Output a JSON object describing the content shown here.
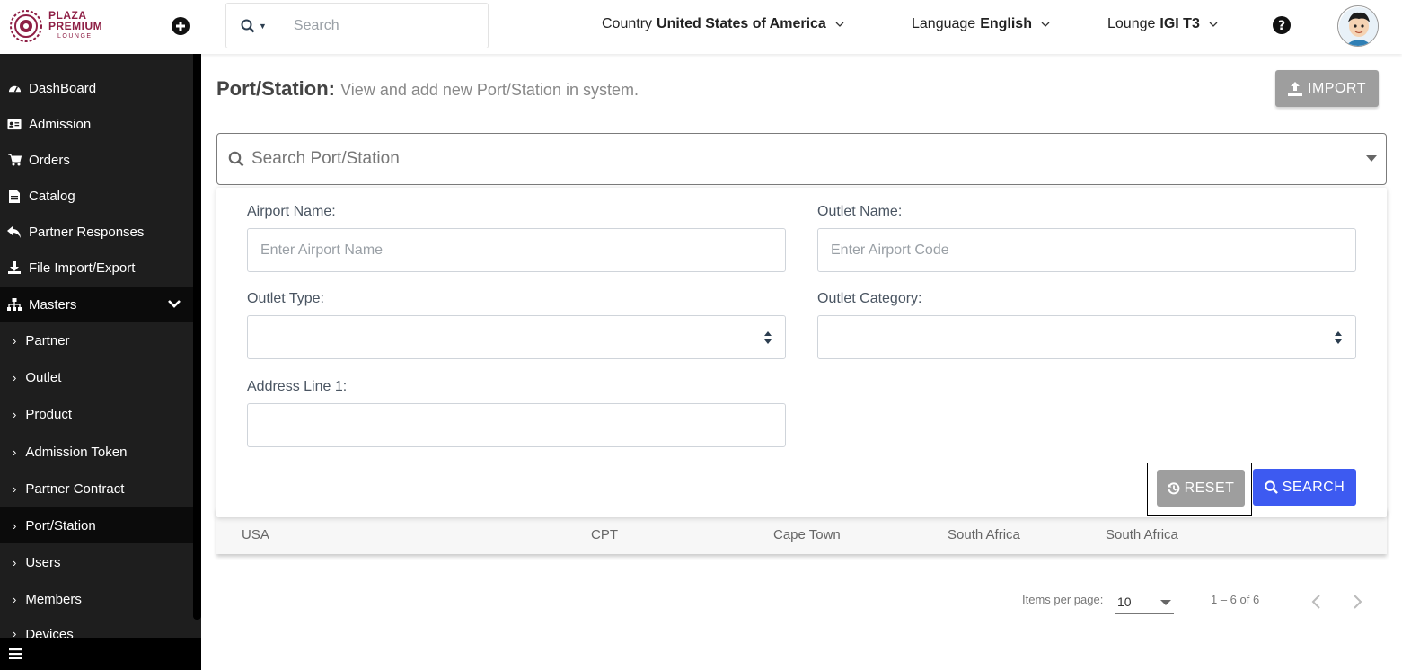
{
  "brand": {
    "line1": "PLAZA",
    "line2": "PREMIUM",
    "line3": "LOUNGE",
    "color": "#8e1f45"
  },
  "topbar": {
    "search_placeholder": "Search",
    "country": {
      "label": "Country",
      "value": "United States of America"
    },
    "language": {
      "label": "Language",
      "value": "English"
    },
    "lounge": {
      "label": "Lounge",
      "value": "IGI T3"
    }
  },
  "sidebar": {
    "items": [
      {
        "label": "DashBoard",
        "icon": "dashboard-icon"
      },
      {
        "label": "Admission",
        "icon": "id-card-icon"
      },
      {
        "label": "Orders",
        "icon": "cart-icon"
      },
      {
        "label": "Catalog",
        "icon": "file-icon"
      },
      {
        "label": "Partner Responses",
        "icon": "reply-icon"
      },
      {
        "label": "File Import/Export",
        "icon": "download-icon"
      },
      {
        "label": "Masters",
        "icon": "sitemap-icon"
      }
    ],
    "sub_items": [
      {
        "label": "Partner"
      },
      {
        "label": "Outlet"
      },
      {
        "label": "Product"
      },
      {
        "label": "Admission Token"
      },
      {
        "label": "Partner Contract"
      },
      {
        "label": "Port/Station",
        "active": true
      },
      {
        "label": "Users"
      },
      {
        "label": "Members"
      },
      {
        "label": "Devices"
      }
    ]
  },
  "page": {
    "title": "Port/Station:",
    "description": "View and add new Port/Station in system.",
    "import_label": "IMPORT",
    "search_placeholder": "Search Port/Station"
  },
  "filters": {
    "airport_name": {
      "label": "Airport Name:",
      "placeholder": "Enter Airport Name"
    },
    "outlet_name": {
      "label": "Outlet Name:",
      "placeholder": "Enter Airport Code"
    },
    "outlet_type": {
      "label": "Outlet Type:",
      "value": ""
    },
    "outlet_category": {
      "label": "Outlet Category:",
      "value": ""
    },
    "address_line_1": {
      "label": "Address Line 1:",
      "value": ""
    },
    "reset_label": "RESET",
    "search_label": "SEARCH"
  },
  "table": {
    "rows": [
      [
        "USA",
        "CPT",
        "Cape Town",
        "South Africa",
        "South Africa"
      ]
    ]
  },
  "pagination": {
    "items_per_page_label": "Items per page:",
    "page_size": "10",
    "range": "1 – 6 of 6"
  },
  "colors": {
    "primary": "#3d5af1",
    "sidebar": "#1e1e1e",
    "muted_button": "#9e9e9e"
  }
}
